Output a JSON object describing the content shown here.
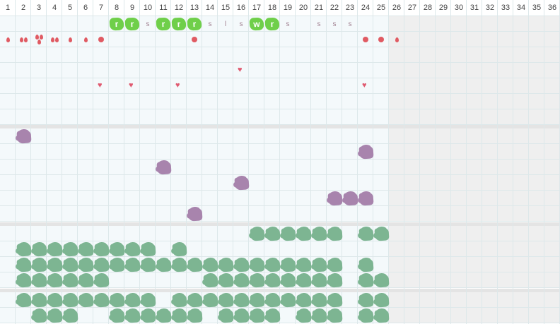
{
  "grid": {
    "day_count": 36,
    "shaded_from_day": 26,
    "day_labels": [
      "1",
      "2",
      "3",
      "4",
      "5",
      "6",
      "7",
      "8",
      "9",
      "10",
      "11",
      "12",
      "13",
      "14",
      "15",
      "16",
      "17",
      "18",
      "19",
      "20",
      "21",
      "22",
      "23",
      "24",
      "25",
      "26",
      "27",
      "28",
      "29",
      "30",
      "31",
      "32",
      "33",
      "34",
      "35",
      "36"
    ]
  },
  "colors": {
    "grid_line": "#dde8ea",
    "section_bg": "#f4f9fb",
    "shaded_bg": "#efefef",
    "purple_blob": "#a884ad",
    "green_blob": "#7db592",
    "bright_green": "#6fcf4a",
    "red": "#e05a62"
  },
  "section1": {
    "green_buttons": [
      {
        "day": 8,
        "label": "r"
      },
      {
        "day": 9,
        "label": "r"
      },
      {
        "day": 11,
        "label": "r"
      },
      {
        "day": 12,
        "label": "r"
      },
      {
        "day": 13,
        "label": "r"
      },
      {
        "day": 17,
        "label": "w"
      },
      {
        "day": 18,
        "label": "r"
      }
    ],
    "letters": [
      {
        "day": 10,
        "label": "s"
      },
      {
        "day": 14,
        "label": "s"
      },
      {
        "day": 15,
        "label": "l"
      },
      {
        "day": 16,
        "label": "s"
      },
      {
        "day": 19,
        "label": "s"
      },
      {
        "day": 21,
        "label": "s"
      },
      {
        "day": 22,
        "label": "s"
      },
      {
        "day": 23,
        "label": "s"
      }
    ],
    "drops": [
      {
        "day": 1,
        "count": 1
      },
      {
        "day": 2,
        "count": 2
      },
      {
        "day": 3,
        "count": 3
      },
      {
        "day": 4,
        "count": 2
      },
      {
        "day": 5,
        "count": 1
      },
      {
        "day": 6,
        "count": 1
      },
      {
        "day": 26,
        "count": 1
      }
    ],
    "dots": [
      7,
      13,
      24,
      25
    ],
    "hearts": [
      {
        "day": 7,
        "row": 4
      },
      {
        "day": 9,
        "row": 4
      },
      {
        "day": 12,
        "row": 4
      },
      {
        "day": 16,
        "row": 3
      },
      {
        "day": 24,
        "row": 4
      }
    ]
  },
  "section2": {
    "blobs": [
      {
        "day": 2,
        "row": 0
      },
      {
        "day": 24,
        "row": 1
      },
      {
        "day": 11,
        "row": 2
      },
      {
        "day": 16,
        "row": 3
      },
      {
        "day": 22,
        "row": 4
      },
      {
        "day": 23,
        "row": 4
      },
      {
        "day": 24,
        "row": 4
      },
      {
        "day": 13,
        "row": 5
      }
    ]
  },
  "section3": {
    "rows": [
      [
        17,
        18,
        19,
        20,
        21,
        22,
        24,
        25
      ],
      [
        2,
        3,
        4,
        5,
        6,
        7,
        8,
        9,
        10,
        12
      ],
      [
        2,
        3,
        4,
        5,
        6,
        7,
        8,
        9,
        10,
        11,
        12,
        13,
        14,
        15,
        16,
        17,
        18,
        19,
        20,
        21,
        22,
        24
      ],
      [
        2,
        3,
        4,
        5,
        6,
        7,
        14,
        15,
        16,
        17,
        18,
        19,
        20,
        21,
        22,
        24,
        25
      ]
    ]
  },
  "section4": {
    "rows": [
      [
        2,
        3,
        4,
        5,
        6,
        7,
        8,
        9,
        10,
        12,
        13,
        14,
        15,
        16,
        17,
        18,
        19,
        20,
        21,
        22,
        24,
        25
      ],
      [
        3,
        4,
        5,
        8,
        9,
        10,
        11,
        12,
        13,
        15,
        16,
        17,
        18,
        20,
        21,
        22,
        24,
        25
      ]
    ]
  }
}
